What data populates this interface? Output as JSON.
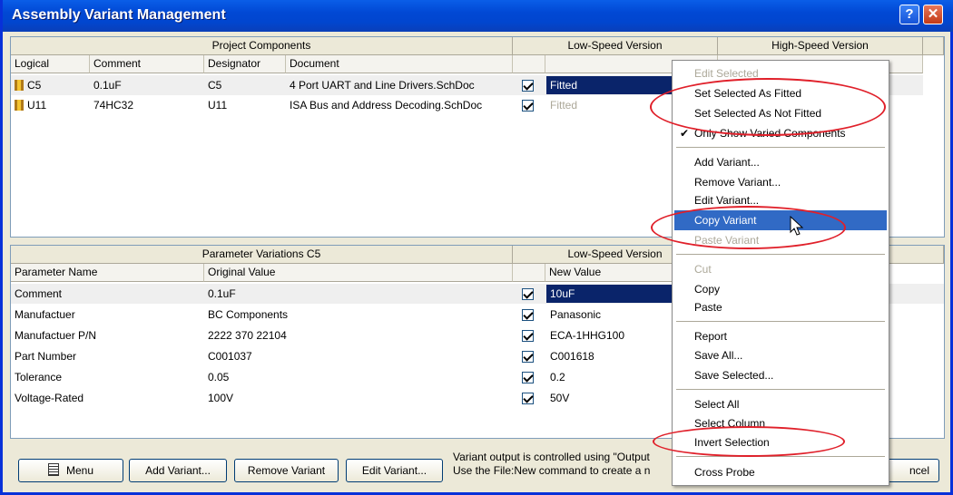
{
  "window": {
    "title": "Assembly Variant Management"
  },
  "top_grid": {
    "group_headers": [
      "Project Components",
      "Low-Speed Version",
      "High-Speed Version"
    ],
    "columns": [
      "Logical",
      "Comment",
      "Designator",
      "Document"
    ],
    "rows": [
      {
        "logical": "C5",
        "comment": "0.1uF",
        "designator": "C5",
        "document": "4 Port UART and Line Drivers.SchDoc",
        "value": "Fitted"
      },
      {
        "logical": "U11",
        "comment": "74HC32",
        "designator": "U11",
        "document": "ISA Bus and Address Decoding.SchDoc",
        "value": "Fitted"
      }
    ]
  },
  "bottom_grid": {
    "group_headers": [
      "Parameter Variations C5",
      "Low-Speed Version"
    ],
    "columns": [
      "Parameter Name",
      "Original Value",
      "New Value"
    ],
    "rows": [
      {
        "name": "Comment",
        "original": "0.1uF",
        "new": "10uF"
      },
      {
        "name": "Manufactuer",
        "original": "BC Components",
        "new": "Panasonic"
      },
      {
        "name": "Manufactuer P/N",
        "original": "2222 370 22104",
        "new": "ECA-1HHG100"
      },
      {
        "name": "Part Number",
        "original": "C001037",
        "new": "C001618"
      },
      {
        "name": "Tolerance",
        "original": "0.05",
        "new": "0.2"
      },
      {
        "name": "Voltage-Rated",
        "original": "100V",
        "new": "50V"
      }
    ]
  },
  "buttons": {
    "menu": "Menu",
    "add_variant": "Add Variant...",
    "remove_variant": "Remove Variant",
    "edit_variant": "Edit Variant...",
    "cancel": "ncel"
  },
  "status": {
    "line1": "Variant output is controlled using \"Output",
    "line2": "Use the File:New command to create a n"
  },
  "context_menu": {
    "items": [
      "Edit Selected",
      "Set Selected As Fitted",
      "Set Selected As Not Fitted",
      "Only Show Varied Components",
      "Add Variant...",
      "Remove Variant...",
      "Edit Variant...",
      "Copy Variant",
      "Paste Variant",
      "Cut",
      "Copy",
      "Paste",
      "Report",
      "Save All...",
      "Save Selected...",
      "Select All",
      "Select Column",
      "Invert Selection",
      "Cross Probe"
    ]
  },
  "colors": {
    "selection": "#0a246a",
    "menu_highlight": "#316ac5",
    "annotation": "#e0202a",
    "title_bar": "#0148d4"
  }
}
